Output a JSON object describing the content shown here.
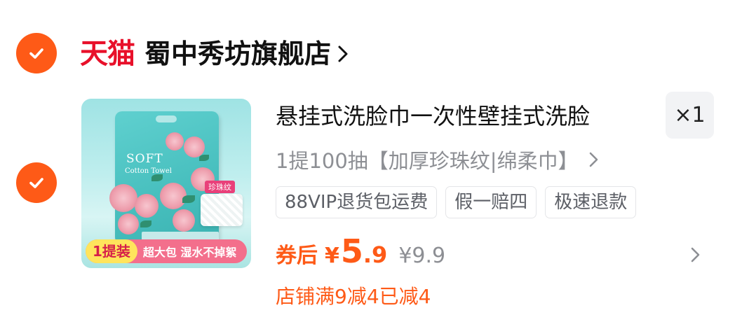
{
  "shop": {
    "logo_text": "天猫",
    "name": "蜀中秀坊旗舰店",
    "selected": true
  },
  "item": {
    "selected": true,
    "title": "悬挂式洗脸巾一次性壁挂式洗脸",
    "sku": "1提100抽【加厚珍珠纹|绵柔巾】",
    "quantity": "×1",
    "tags": [
      "88VIP退货包运费",
      "假一赔四",
      "极速退款"
    ],
    "price": {
      "label": "券后",
      "currency": "¥",
      "integer": "5",
      "decimal": ".9",
      "original": "¥9.9"
    },
    "discount_text": "店铺满9减4已减4",
    "image": {
      "brand": "SOFT",
      "subtitle": "Cotton Towel",
      "pearl_tag": "珍珠纹",
      "badge_main": "1提装",
      "badge_sub": "超大包 湿水不掉絮"
    }
  },
  "colors": {
    "accent": "#fe5a17",
    "tmall_red": "#e8102a"
  },
  "icons": {
    "check": "check-icon",
    "chevron": "chevron-right-icon"
  }
}
